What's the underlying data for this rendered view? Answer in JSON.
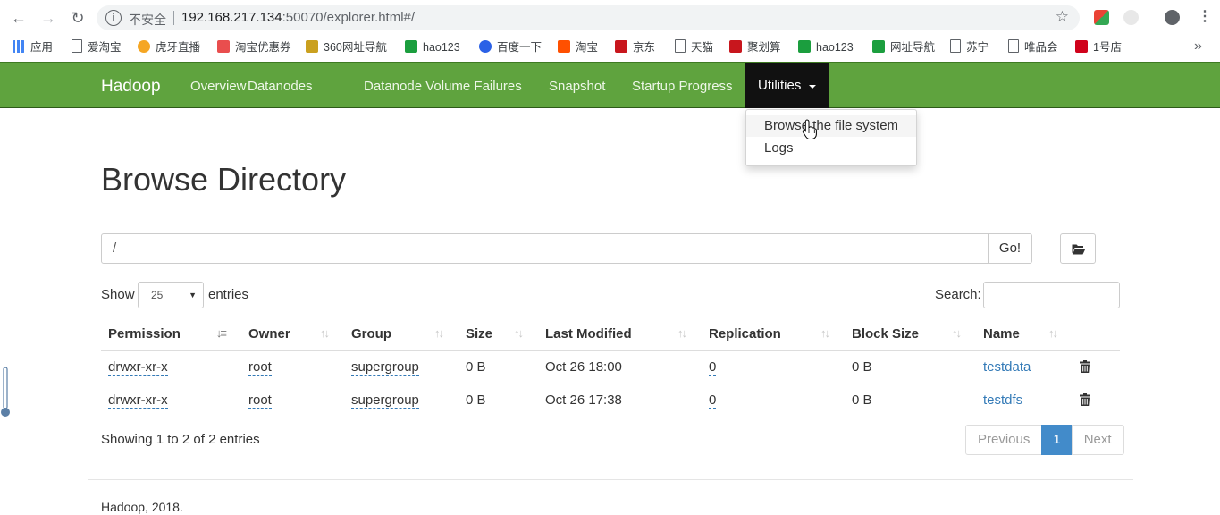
{
  "browser": {
    "insecure_label": "不安全",
    "url_host": "192.168.217.134",
    "url_rest": ":50070/explorer.html#/",
    "bookmarks": [
      {
        "label": "应用",
        "icon": "apps-grid-icon",
        "color": "#4285f4"
      },
      {
        "label": "爱淘宝",
        "icon": "page-icon",
        "color": "#ffffff"
      },
      {
        "label": "虎牙直播",
        "icon": "huya-icon",
        "color": "#f5a623"
      },
      {
        "label": "淘宝优惠券",
        "icon": "coupon-icon",
        "color": "#e94e4e"
      },
      {
        "label": "360网址导航",
        "icon": "360-icon",
        "color": "#caa01f"
      },
      {
        "label": "hao123",
        "icon": "hao123-icon",
        "color": "#1b9e3e"
      },
      {
        "label": "百度一下",
        "icon": "baidu-paw-icon",
        "color": "#2b61e6"
      },
      {
        "label": "淘宝",
        "icon": "taobao-icon",
        "color": "#ff5000"
      },
      {
        "label": "京东",
        "icon": "jd-icon",
        "color": "#c8161d"
      },
      {
        "label": "天猫",
        "icon": "page-icon",
        "color": "#ffffff"
      },
      {
        "label": "聚划算",
        "icon": "juhuasuan-icon",
        "color": "#c8161d"
      },
      {
        "label": "hao123",
        "icon": "hao123-icon",
        "color": "#1b9e3e"
      },
      {
        "label": "网址导航",
        "icon": "hao123-icon",
        "color": "#1b9e3e"
      },
      {
        "label": "苏宁",
        "icon": "page-icon",
        "color": "#ffffff"
      },
      {
        "label": "唯品会",
        "icon": "page-icon",
        "color": "#ffffff"
      },
      {
        "label": "1号店",
        "icon": "yhd-icon",
        "color": "#d0021b"
      }
    ],
    "more_label": "»"
  },
  "navbar": {
    "brand": "Hadoop",
    "links": [
      "Overview",
      "Datanodes",
      "Datanode Volume Failures",
      "Snapshot",
      "Startup Progress"
    ],
    "utilities_label": "Utilities",
    "dropdown": [
      "Browse the file system",
      "Logs"
    ],
    "color": "#5fa33e"
  },
  "page": {
    "title": "Browse Directory",
    "path_value": "/",
    "go_label": "Go!",
    "show_label": "Show",
    "page_length": "25",
    "entries_label": "entries",
    "search_label": "Search:",
    "columns": [
      "Permission",
      "Owner",
      "Group",
      "Size",
      "Last Modified",
      "Replication",
      "Block Size",
      "Name"
    ],
    "rows": [
      {
        "permission": "drwxr-xr-x",
        "owner": "root",
        "group": "supergroup",
        "size": "0 B",
        "modified": "Oct 26 18:00",
        "replication": "0",
        "block_size": "0 B",
        "name": "testdata"
      },
      {
        "permission": "drwxr-xr-x",
        "owner": "root",
        "group": "supergroup",
        "size": "0 B",
        "modified": "Oct 26 17:38",
        "replication": "0",
        "block_size": "0 B",
        "name": "testdfs"
      }
    ],
    "info": "Showing 1 to 2 of 2 entries",
    "pager": {
      "previous": "Previous",
      "current": "1",
      "next": "Next"
    },
    "footer": "Hadoop, 2018.",
    "link_color": "#337ab7",
    "pager_active_color": "#428bca"
  }
}
